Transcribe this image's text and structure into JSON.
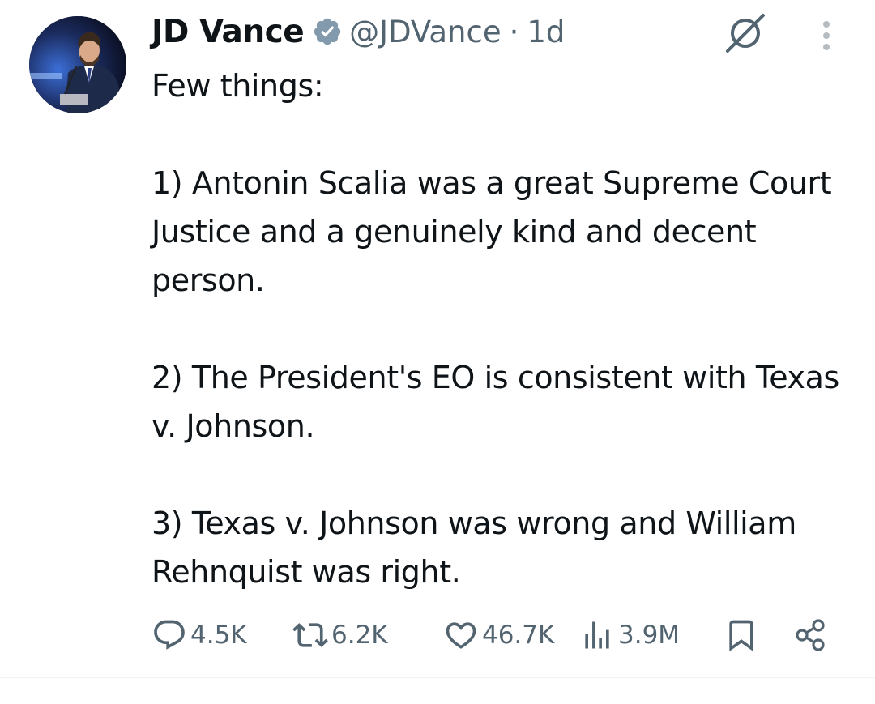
{
  "tweet": {
    "author_name": "JD Vance",
    "handle": "@JDVance",
    "separator": "·",
    "timestamp": "1d",
    "text_lines": [
      "Few things:",
      "1) Antonin Scalia was a great Supreme Court Justice and a genuinely kind and decent person.",
      "2) The President's EO is consistent with Texas v. Johnson.",
      "3) Texas v. Johnson was wrong and William Rehnquist was right."
    ],
    "metrics": {
      "replies": "4.5K",
      "reposts": "6.2K",
      "likes": "46.7K",
      "views": "3.9M"
    }
  },
  "icons": {
    "verified": "verified-badge-icon",
    "grok": "grok-icon",
    "more": "more-vertical-icon",
    "reply": "reply-icon",
    "repost": "repost-icon",
    "like": "like-icon",
    "views": "views-icon",
    "bookmark": "bookmark-icon",
    "share": "share-icon"
  },
  "colors": {
    "text": "#0f1419",
    "secondary": "#536471",
    "verified_badge": "#829aab"
  }
}
